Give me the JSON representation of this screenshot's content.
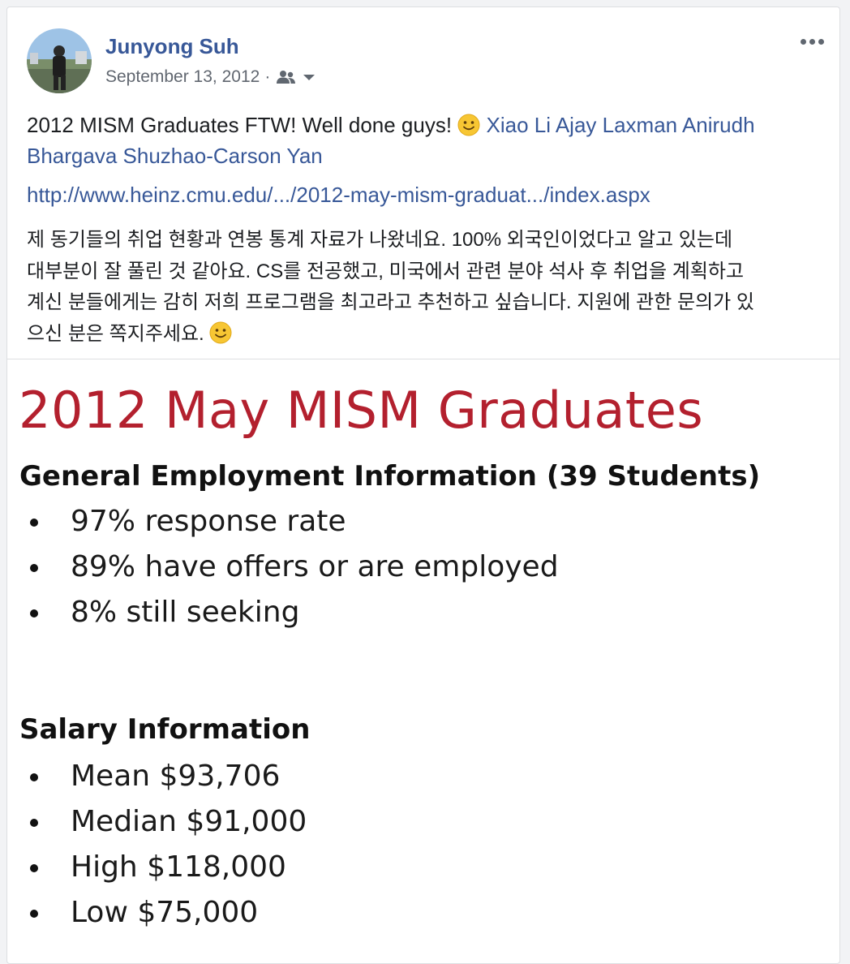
{
  "post": {
    "author": "Junyong Suh",
    "date": "September 13, 2012",
    "separator": "·",
    "audience_icon": "friends-icon",
    "more_icon": "more-options-icon",
    "text_prefix": "2012 MISM Graduates FTW! Well done guys!",
    "emoji": "slightly-smiling-face-emoji",
    "tags": [
      "Xiao Li",
      "Ajay Laxman",
      "Anirudh Bhargava",
      "Shuzhao-Carson Yan"
    ],
    "url": "http://www.heinz.cmu.edu/.../2012-may-mism-graduat.../index.aspx",
    "korean_lines": [
      "제 동기들의 취업 현황과 연봉 통계 자료가 나왔네요. 100% 외국인이었다고 알고 있는데",
      "대부분이 잘 풀린 것 같아요. CS를 전공했고, 미국에서 관련 분야 석사 후 취업을 계획하고",
      "계신 분들에게는 감히 저희 프로그램을 최고라고 추천하고 싶습니다. 지원에 관한 문의가 있",
      "으신 분은 쪽지주세요."
    ]
  },
  "image": {
    "title": "2012 May MISM Graduates",
    "title_color": "#b3202e",
    "section1": {
      "heading": "General Employment Information (39 Students)",
      "items": [
        "97% response rate",
        "89% have offers or are employed",
        "8% still seeking"
      ]
    },
    "section2": {
      "heading": "Salary Information",
      "items": [
        "Mean $93,706",
        "Median $91,000",
        "High $118,000",
        "Low $75,000"
      ]
    }
  },
  "colors": {
    "link": "#385898",
    "meta": "#616770",
    "background": "#f2f3f5"
  }
}
